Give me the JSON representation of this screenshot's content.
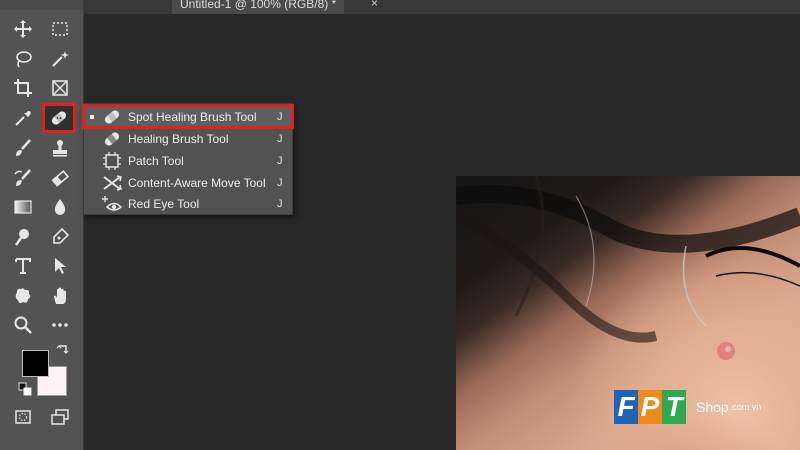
{
  "document": {
    "tab_title": "Untitled-1 @ 100% (RGB/8) *",
    "close_label": "×"
  },
  "toolbar": {
    "tools": [
      {
        "id": "move",
        "icon": "move-icon"
      },
      {
        "id": "marquee",
        "icon": "rectangular-marquee-icon"
      },
      {
        "id": "lasso",
        "icon": "lasso-icon"
      },
      {
        "id": "magic-wand",
        "icon": "magic-wand-icon"
      },
      {
        "id": "crop",
        "icon": "crop-icon"
      },
      {
        "id": "frame",
        "icon": "frame-icon"
      },
      {
        "id": "eyedropper",
        "icon": "eyedropper-icon"
      },
      {
        "id": "spot-healing",
        "icon": "bandage-icon",
        "active": true
      },
      {
        "id": "brush",
        "icon": "brush-icon"
      },
      {
        "id": "clone-stamp",
        "icon": "stamp-icon"
      },
      {
        "id": "history-brush",
        "icon": "history-brush-icon"
      },
      {
        "id": "eraser",
        "icon": "eraser-icon"
      },
      {
        "id": "gradient",
        "icon": "gradient-icon"
      },
      {
        "id": "blur",
        "icon": "drop-icon"
      },
      {
        "id": "dodge",
        "icon": "dodge-icon"
      },
      {
        "id": "pen",
        "icon": "pen-icon"
      },
      {
        "id": "type",
        "icon": "type-icon"
      },
      {
        "id": "path-selection",
        "icon": "arrow-icon"
      },
      {
        "id": "shape",
        "icon": "custom-shape-icon"
      },
      {
        "id": "hand",
        "icon": "hand-icon"
      },
      {
        "id": "zoom",
        "icon": "zoom-icon"
      },
      {
        "id": "more",
        "icon": "more-icon"
      }
    ],
    "foreground_color": "#000000",
    "background_color": "#fff2f6"
  },
  "menu": {
    "items": [
      {
        "label": "Spot Healing Brush Tool",
        "shortcut": "J",
        "icon": "bandage-icon",
        "selected": true
      },
      {
        "label": "Healing Brush Tool",
        "shortcut": "J",
        "icon": "healing-brush-icon"
      },
      {
        "label": "Patch Tool",
        "shortcut": "J",
        "icon": "patch-icon"
      },
      {
        "label": "Content-Aware Move Tool",
        "shortcut": "J",
        "icon": "content-aware-move-icon"
      },
      {
        "label": "Red Eye Tool",
        "shortcut": "J",
        "icon": "red-eye-icon"
      }
    ]
  },
  "watermark": {
    "letters": [
      "F",
      "P",
      "T"
    ],
    "shop": "Shop",
    "domain": ".com.vn"
  }
}
